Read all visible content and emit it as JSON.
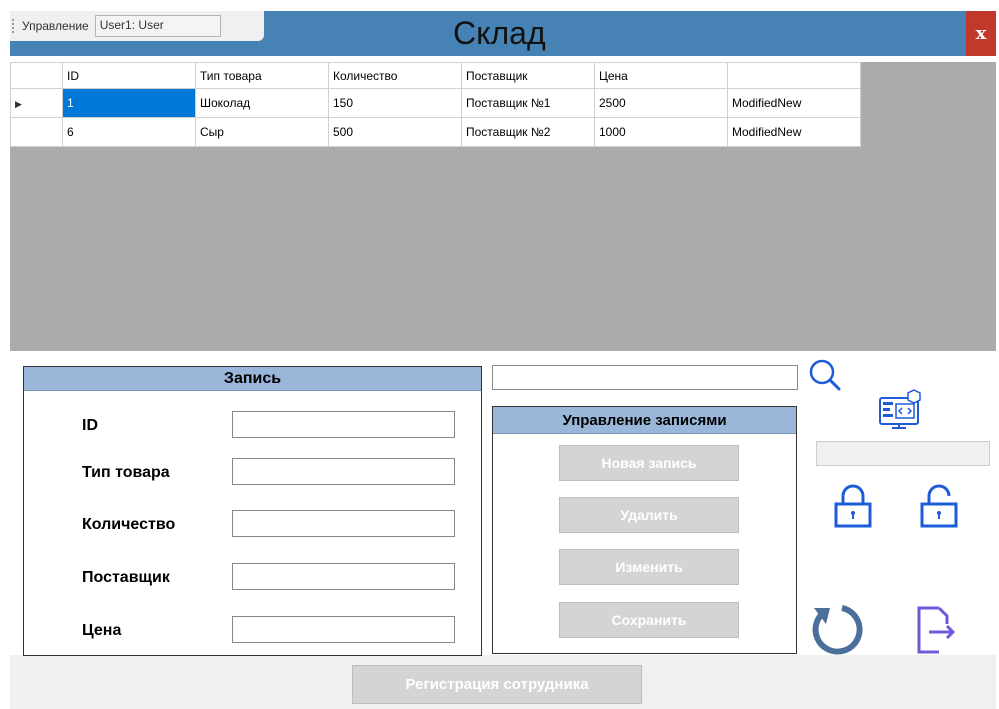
{
  "menu": {
    "label": "Управление",
    "user": "User1: User"
  },
  "window": {
    "title": "Склад",
    "close": "x"
  },
  "grid": {
    "columns": [
      "ID",
      "Тип товара",
      "Количество",
      "Поставщик",
      "Цена",
      ""
    ],
    "rows": [
      [
        "1",
        "Шоколад",
        "150",
        "Поставщик №1",
        "2500",
        "ModifiedNew"
      ],
      [
        "6",
        "Сыр",
        "500",
        "Поставщик №2",
        "1000",
        "ModifiedNew"
      ]
    ],
    "current_row_marker": "▶"
  },
  "record": {
    "title": "Запись",
    "fields": [
      {
        "label": "ID",
        "value": ""
      },
      {
        "label": "Тип товара",
        "value": ""
      },
      {
        "label": "Количество",
        "value": ""
      },
      {
        "label": "Поставщик",
        "value": ""
      },
      {
        "label": "Цена",
        "value": ""
      }
    ]
  },
  "search": {
    "value": ""
  },
  "management": {
    "title": "Управление записями",
    "buttons": [
      "Новая запись",
      "Удалить",
      "Изменить",
      "Сохранить"
    ]
  },
  "register_button": "Регистрация сотрудника",
  "icons": {
    "search": "search-icon",
    "computer": "computer-code-icon",
    "lock": "lock-closed-icon",
    "unlock": "lock-open-icon",
    "refresh": "refresh-icon",
    "logout": "logout-icon"
  },
  "colors": {
    "title_bar": "#4682b4",
    "panel_header": "#9ab6d8",
    "selection": "#0078d7",
    "close": "#c0392b",
    "icon_blue": "#1e5bd8",
    "icon_grey_blue": "#4a6f9a",
    "icon_purple": "#6b5bd8"
  }
}
